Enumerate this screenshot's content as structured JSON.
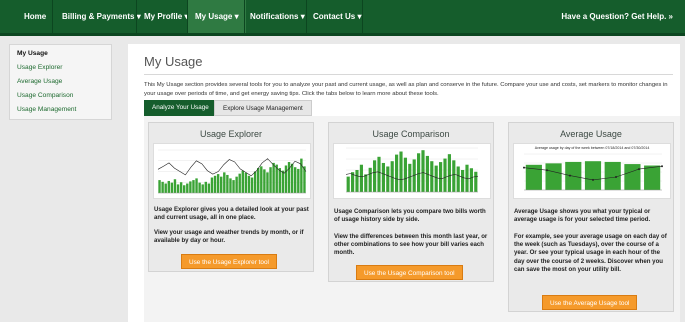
{
  "nav": {
    "home": "Home",
    "billing": "Billing & Payments",
    "profile": "My Profile",
    "usage": "My Usage",
    "notifications": "Notifications",
    "contact": "Contact Us",
    "caret": "▾",
    "help": "Have a Question? Get Help. »"
  },
  "sidebar": {
    "items": [
      "My Usage",
      "Usage Explorer",
      "Average Usage",
      "Usage Comparison",
      "Usage Management"
    ]
  },
  "page": {
    "title": "My Usage",
    "intro": "This My Usage section provides several tools for you to analyze your past and current usage, as well as plan and conserve in the future. Compare your use and costs, set markers to monitor changes in your usage over periods of time, and get energy saving tips. Click the tabs below to learn more about these tools."
  },
  "tabs": [
    "Analyze Your Usage",
    "Explore Usage Management"
  ],
  "cards": [
    {
      "title": "Usage Explorer",
      "p1": "Usage Explorer gives you a detailed look at your past and current usage, all in one place.",
      "p2": "View your usage and weather trends by month, or if available by day or hour.",
      "button": "Use the Usage Explorer tool"
    },
    {
      "title": "Usage Comparison",
      "p1": "Usage Comparison lets you compare two bills worth of usage history side by side.",
      "p2": "View the differences between this month last year, or other combinations to see how your bill varies each month.",
      "button": "Use the Usage Comparison tool"
    },
    {
      "title": "Average Usage",
      "chart_title": "Average usage by day of the week between 07/18/2014 and 07/30/2014",
      "p1": "Average Usage shows you what your typical or average usage is for your selected time period.",
      "p2": "For example, see your average usage on each day of the week (such as Tuesdays), over the course of a year. Or see your typical usage in each hour of the day over the course of 2 weeks. Discover when you can save the most on your utility bill.",
      "button": "Use the Average Usage tool"
    }
  ],
  "thumbnails": {
    "bar_color": "#3aa335",
    "line_color": "#222222",
    "explorer_bars": [
      0.3,
      0.26,
      0.22,
      0.28,
      0.24,
      0.32,
      0.2,
      0.25,
      0.18,
      0.22,
      0.27,
      0.3,
      0.34,
      0.24,
      0.2,
      0.26,
      0.22,
      0.36,
      0.4,
      0.44,
      0.38,
      0.48,
      0.42,
      0.34,
      0.3,
      0.38,
      0.45,
      0.52,
      0.47,
      0.4,
      0.36,
      0.5,
      0.58,
      0.62,
      0.55,
      0.48,
      0.6,
      0.7,
      0.66,
      0.58,
      0.52,
      0.64,
      0.72,
      0.68,
      0.6,
      0.56,
      0.8,
      0.62
    ],
    "explorer_line": [
      0.55,
      0.62,
      0.7,
      0.58,
      0.5,
      0.42,
      0.6,
      0.75,
      0.68,
      0.52,
      0.44,
      0.5,
      0.66,
      0.78,
      0.72,
      0.56,
      0.48,
      0.4,
      0.52,
      0.7,
      0.8,
      0.66,
      0.54,
      0.46,
      0.58,
      0.74,
      0.68,
      0.5
    ],
    "comparison_bars": [
      0.35,
      0.45,
      0.5,
      0.62,
      0.4,
      0.55,
      0.72,
      0.8,
      0.66,
      0.58,
      0.7,
      0.85,
      0.92,
      0.78,
      0.64,
      0.74,
      0.88,
      0.95,
      0.82,
      0.7,
      0.6,
      0.68,
      0.76,
      0.86,
      0.72,
      0.58,
      0.5,
      0.62,
      0.54,
      0.46
    ],
    "comparison_line": [
      0.4,
      0.42,
      0.38,
      0.35,
      0.36,
      0.4,
      0.44,
      0.46,
      0.42,
      0.38,
      0.34,
      0.3,
      0.28,
      0.3,
      0.34,
      0.38,
      0.42,
      0.44,
      0.4,
      0.36,
      0.32,
      0.3,
      0.34,
      0.38,
      0.4,
      0.36,
      0.32,
      0.3,
      0.34,
      0.36
    ],
    "average_bars": [
      0.7,
      0.74,
      0.78,
      0.8,
      0.78,
      0.72,
      0.68
    ],
    "average_line": [
      0.62,
      0.55,
      0.4,
      0.28,
      0.36,
      0.58,
      0.66
    ]
  }
}
